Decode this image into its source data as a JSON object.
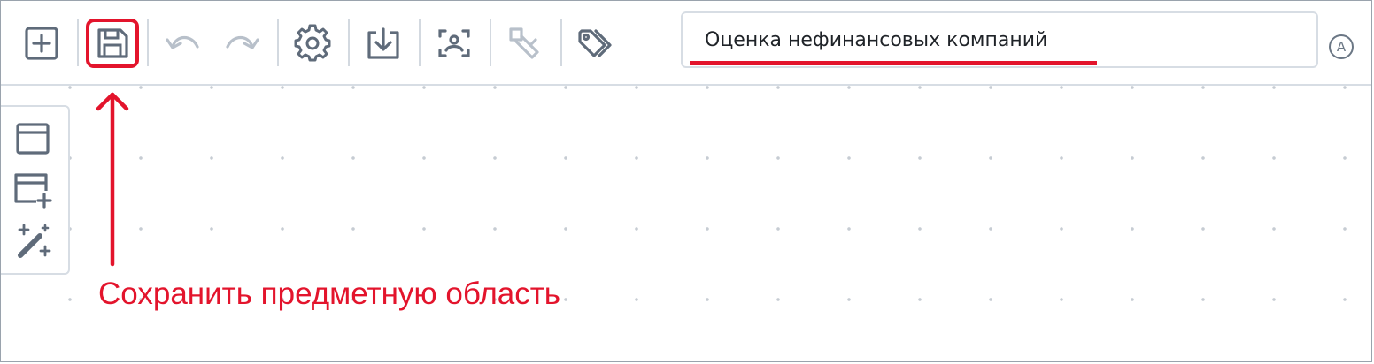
{
  "toolbar": {
    "buttons": [
      {
        "id": "new",
        "icon": "plus-square-icon",
        "enabled": true
      },
      {
        "id": "save",
        "icon": "save-icon",
        "enabled": true
      },
      {
        "id": "undo",
        "icon": "undo-icon",
        "enabled": false
      },
      {
        "id": "redo",
        "icon": "redo-icon",
        "enabled": false
      },
      {
        "id": "settings",
        "icon": "gear-icon",
        "enabled": true
      },
      {
        "id": "import",
        "icon": "download-icon",
        "enabled": true
      },
      {
        "id": "recognize",
        "icon": "scan-icon",
        "enabled": true
      },
      {
        "id": "edit-tags",
        "icon": "tag-edit-icon",
        "enabled": false
      },
      {
        "id": "tags",
        "icon": "tags-icon",
        "enabled": true
      }
    ],
    "domain_name": "Оценка нефинансовых компаний",
    "status_glyph": "A"
  },
  "side_panel": {
    "buttons": [
      {
        "icon": "window-icon"
      },
      {
        "icon": "window-add-icon"
      },
      {
        "icon": "magic-wand-icon"
      }
    ]
  },
  "annotation": {
    "text": "Сохранить предметную область"
  },
  "colors": {
    "accent": "#e3142c",
    "icon": "#5f6b7a",
    "icon_disabled": "#b8c0ca",
    "border": "#d7dde4"
  }
}
